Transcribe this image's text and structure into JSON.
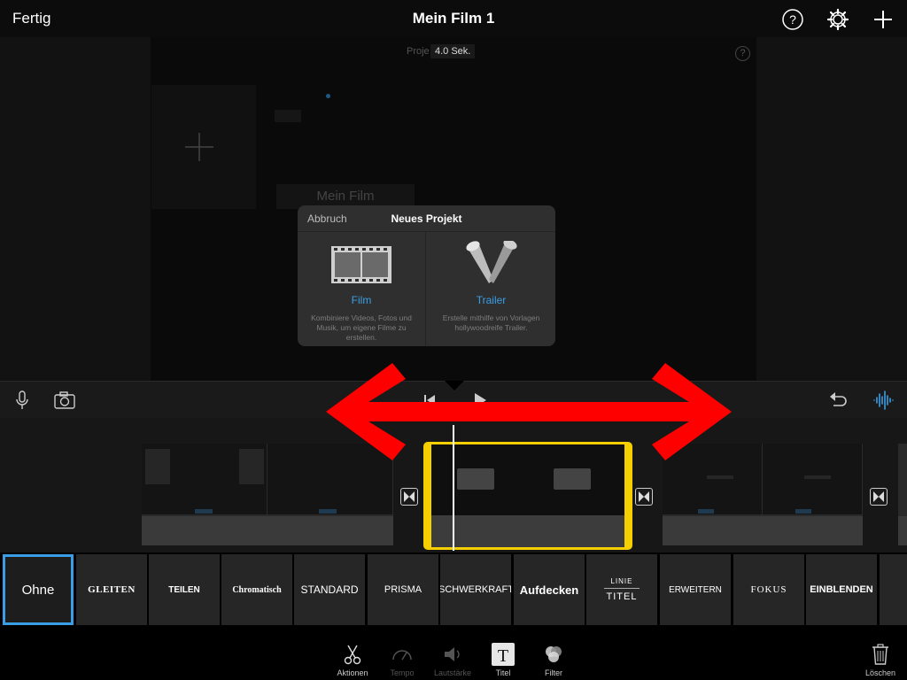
{
  "topbar": {
    "done_label": "Fertig",
    "title": "Mein Film 1"
  },
  "viewer": {
    "project_label": "Proje",
    "duration_badge": "4.0 Sek.",
    "help_mark": "?",
    "ghost_movie_title": "Mein Film"
  },
  "popup": {
    "cancel_label": "Abbruch",
    "title": "Neues Projekt",
    "options": [
      {
        "name": "Film",
        "description": "Kombiniere Videos, Fotos und Musik, um eigene Filme zu erstellen."
      },
      {
        "name": "Trailer",
        "description": "Erstelle mithilfe von Vorlagen hollywoodreife Trailer."
      }
    ]
  },
  "title_styles": [
    "Ohne",
    "GLEITEN",
    "TEILEN",
    "Chromatisch",
    "STANDARD",
    "PRISMA",
    "SCHWERKRAFT",
    "Aufdecken",
    "LINIE",
    "TITEL",
    "ERWEITERN",
    "FOKUS",
    "EINBLENDEN"
  ],
  "selected_style": "Ohne",
  "toolbar": {
    "tools": [
      {
        "label": "Aktionen",
        "icon": "scissors-icon"
      },
      {
        "label": "Tempo",
        "icon": "speedometer-icon"
      },
      {
        "label": "Lautstärke",
        "icon": "speaker-icon"
      },
      {
        "label": "Titel",
        "icon": "title-t-icon"
      },
      {
        "label": "Filter",
        "icon": "filter-circles-icon"
      }
    ],
    "delete_label": "Löschen"
  },
  "colors": {
    "accent_blue": "#3a9ee6",
    "selection_yellow": "#f5cf00",
    "overlay_arrow_red": "#ff0000"
  }
}
